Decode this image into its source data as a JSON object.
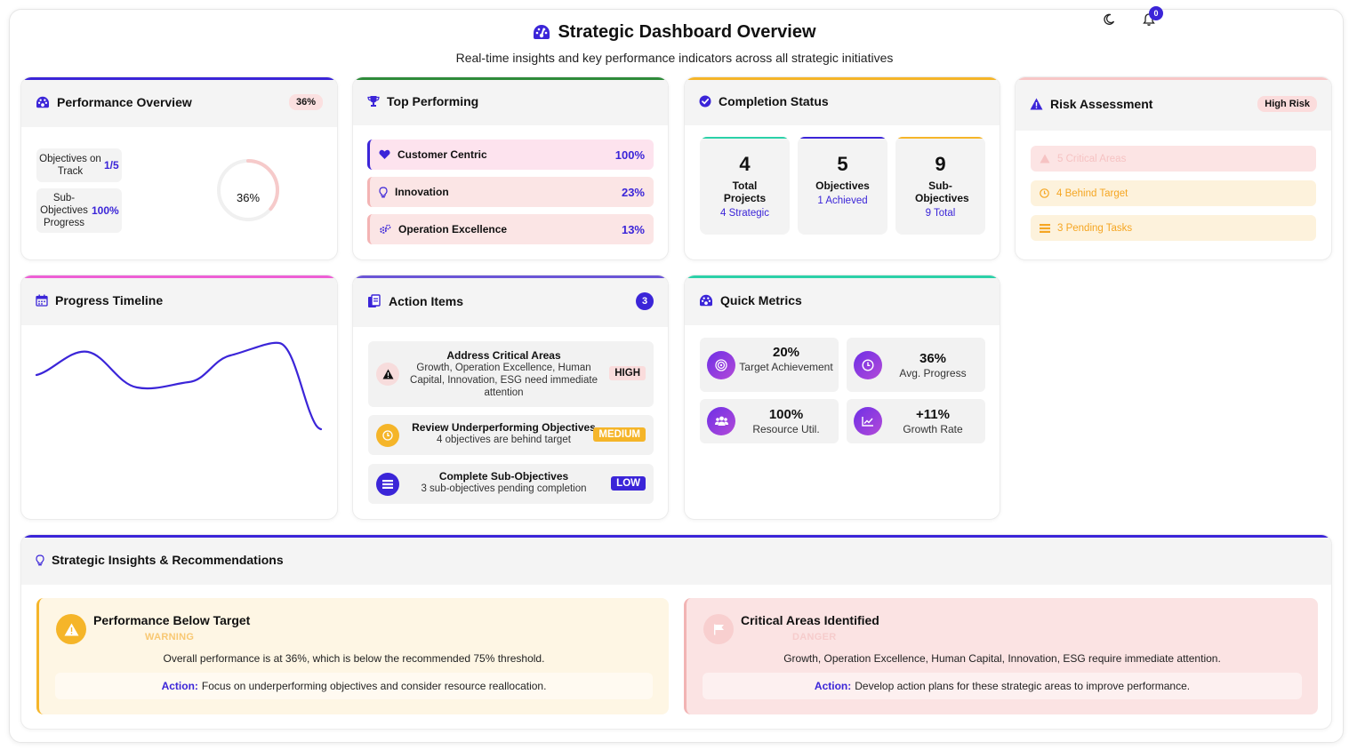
{
  "header": {
    "title": "Strategic Dashboard Overview",
    "subtitle": "Real-time insights and key performance indicators across all strategic initiatives",
    "notification_count": "0"
  },
  "performance_overview": {
    "title": "Performance Overview",
    "badge": "36%",
    "objectives_label": "Objectives on Track",
    "objectives_value": "1/5",
    "subobjectives_label": "Sub-Objectives Progress",
    "subobjectives_value": "100%",
    "gauge_label": "36%",
    "gauge_progress": 0.36
  },
  "top_performing": {
    "title": "Top Performing",
    "items": [
      {
        "label": "Customer Centric",
        "value": "100%"
      },
      {
        "label": "Innovation",
        "value": "23%"
      },
      {
        "label": "Operation Excellence",
        "value": "13%"
      }
    ]
  },
  "completion_status": {
    "title": "Completion Status",
    "boxes": [
      {
        "number": "4",
        "title": "Total Projects",
        "sub": "4 Strategic"
      },
      {
        "number": "5",
        "title": "Objectives",
        "sub": "1 Achieved"
      },
      {
        "number": "9",
        "title": "Sub-Objectives",
        "sub": "9 Total"
      }
    ]
  },
  "risk_assessment": {
    "title": "Risk Assessment",
    "badge": "High Risk",
    "items": [
      {
        "label": "5 Critical Areas"
      },
      {
        "label": "4 Behind Target"
      },
      {
        "label": "3 Pending Tasks"
      }
    ]
  },
  "progress_timeline": {
    "title": "Progress Timeline"
  },
  "action_items": {
    "title": "Action Items",
    "count": "3",
    "items": [
      {
        "title": "Address Critical Areas",
        "desc": "Growth, Operation Excellence, Human Capital, Innovation, ESG need immediate attention",
        "priority": "HIGH"
      },
      {
        "title": "Review Underperforming Objectives",
        "desc": "4 objectives are behind target",
        "priority": "MEDIUM"
      },
      {
        "title": "Complete Sub-Objectives",
        "desc": "3 sub-objectives pending completion",
        "priority": "LOW"
      }
    ]
  },
  "quick_metrics": {
    "title": "Quick Metrics",
    "items": [
      {
        "value": "20%",
        "label": "Target Achievement"
      },
      {
        "value": "36%",
        "label": "Avg. Progress"
      },
      {
        "value": "100%",
        "label": "Resource Util."
      },
      {
        "value": "+11%",
        "label": "Growth Rate"
      }
    ]
  },
  "insights": {
    "title": "Strategic Insights & Recommendations",
    "cards": [
      {
        "title": "Performance Below Target",
        "severity": "WARNING",
        "body": "Overall performance is at 36%, which is below the recommended 75% threshold.",
        "action_label": "Action:",
        "action_text": "Focus on underperforming objectives and consider resource reallocation."
      },
      {
        "title": "Critical Areas Identified",
        "severity": "DANGER",
        "body": "Growth, Operation Excellence, Human Capital, Innovation, ESG require immediate attention.",
        "action_label": "Action:",
        "action_text": "Develop action plans for these strategic areas to improve performance."
      }
    ]
  },
  "colors": {
    "accent": "#3b25d8",
    "warning": "#f5a623",
    "danger": "#e57373",
    "success": "#2bd1a8"
  }
}
